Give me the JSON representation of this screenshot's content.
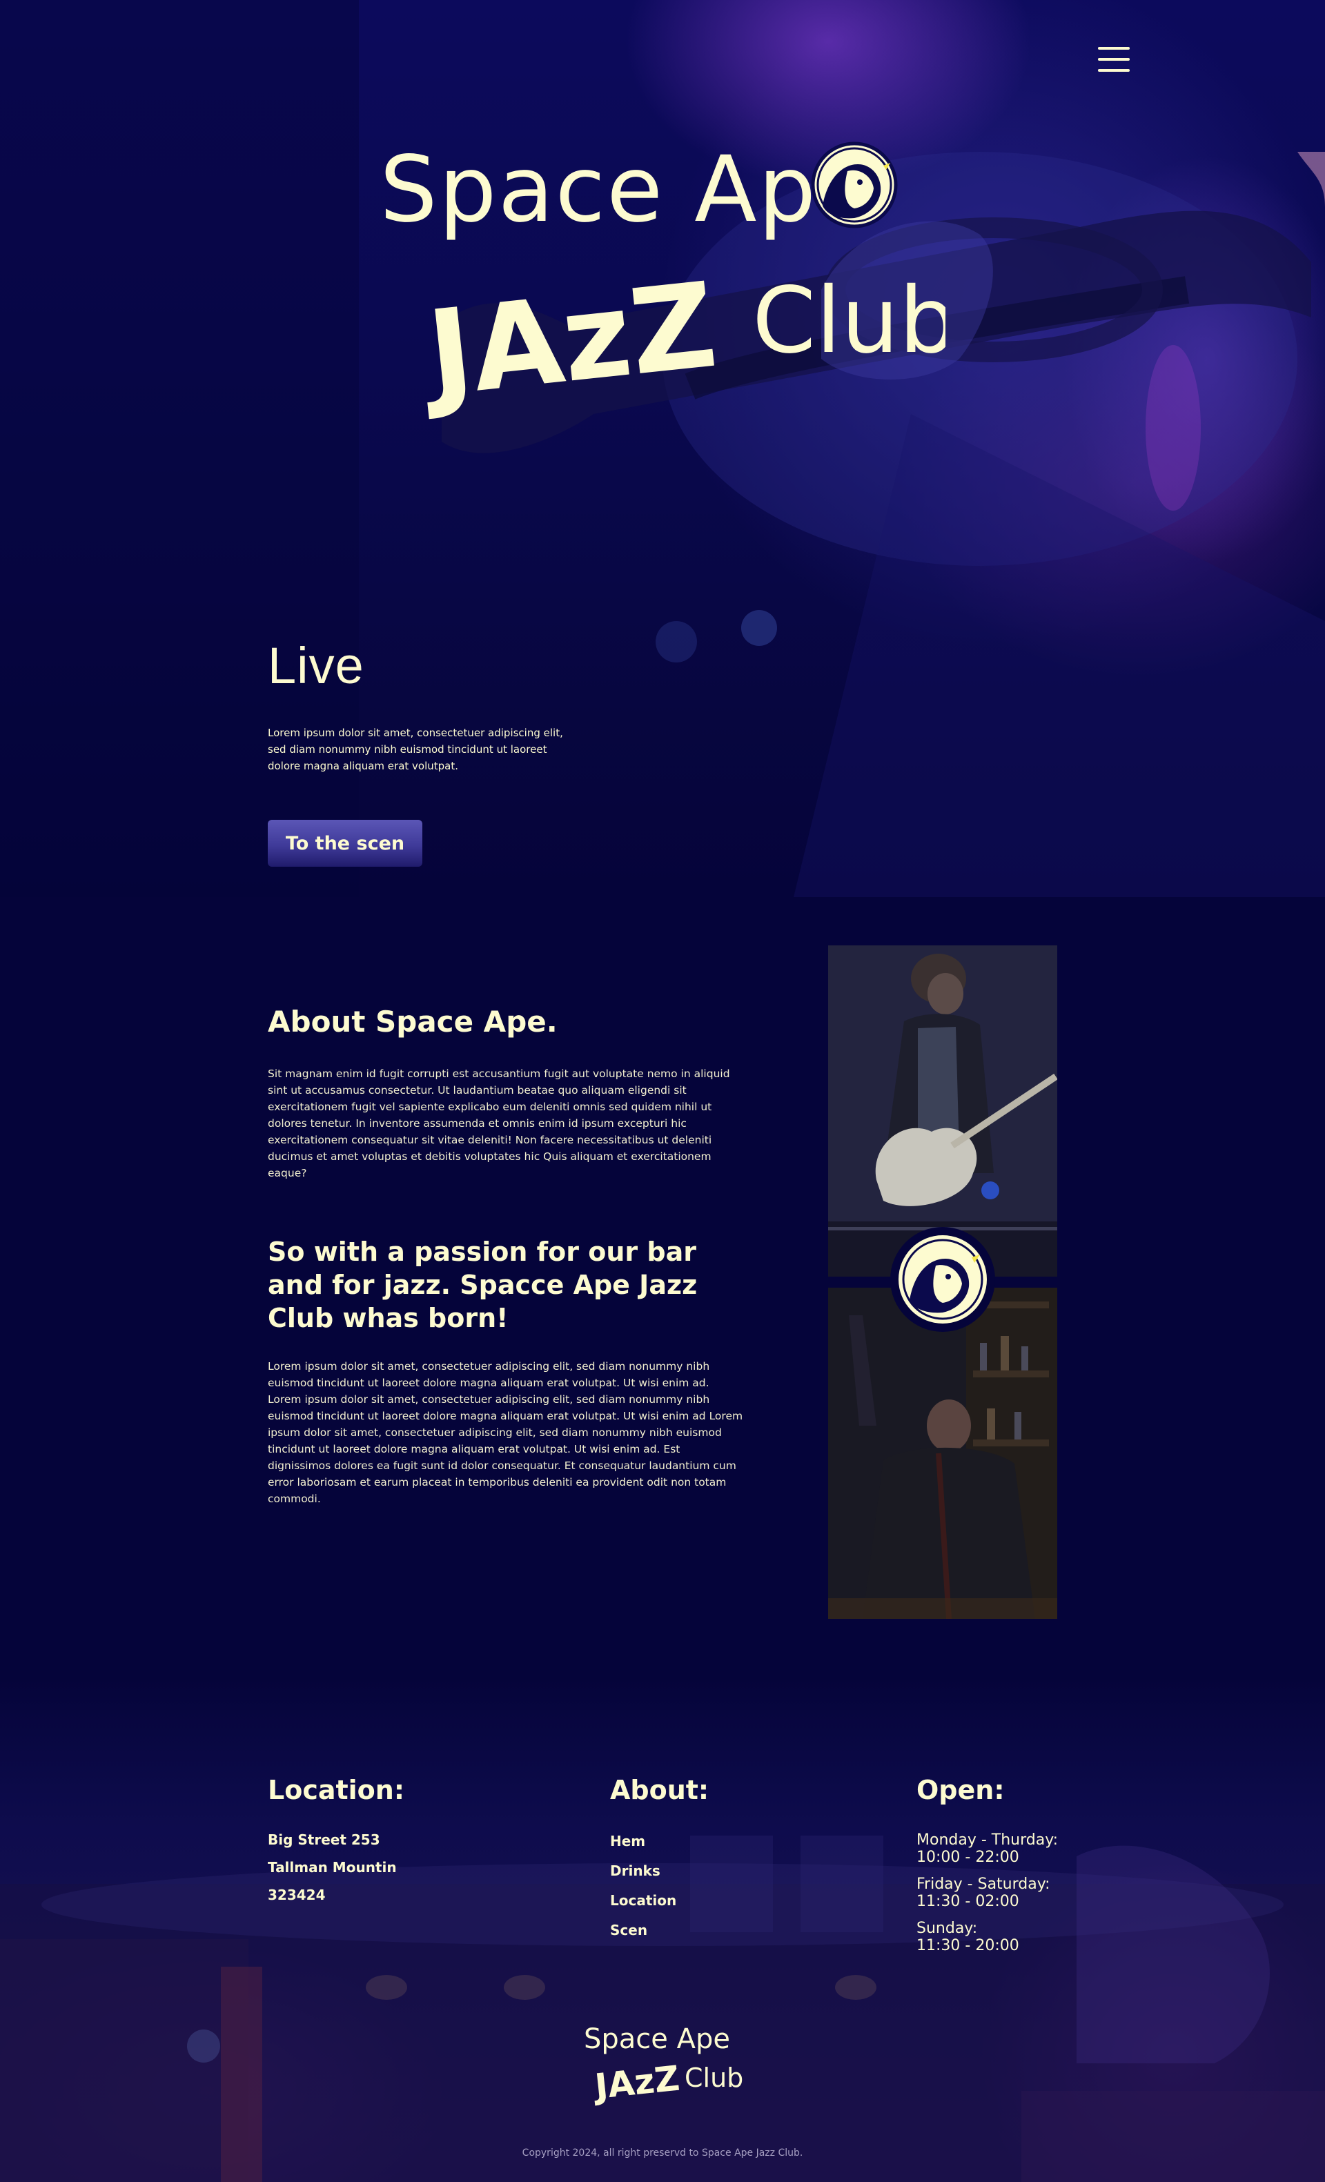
{
  "brand": {
    "logo_line1": "Space Ape",
    "logo_jazz": "JAzZ",
    "logo_club": "Club",
    "accent_color": "#fdfbd0",
    "background_color": "#05043a",
    "button_color": "#4a45a6"
  },
  "header": {
    "menu_icon": "hamburger-menu-icon"
  },
  "hero": {
    "title": "Live",
    "text": "Lorem ipsum dolor sit amet, consectetuer adipiscing elit, sed diam nonummy nibh euismod tincidunt ut laoreet dolore magna aliquam erat volutpat.",
    "button_label": "To the scen"
  },
  "about": {
    "title": "About Space Ape.",
    "text": "Sit magnam enim id fugit corrupti est accusantium fugit aut voluptate nemo in aliquid sint ut accusamus consectetur. Ut laudantium beatae quo aliquam eligendi sit exercitationem fugit vel sapiente explicabo eum deleniti omnis sed quidem nihil ut dolores tenetur. In inventore assumenda et omnis enim id ipsum excepturi hic exercitationem consequatur sit vitae deleniti! Non facere necessitatibus ut deleniti ducimus et amet voluptas et debitis voluptates hic Quis aliquam et exercitationem eaque?",
    "passion_title": "So with a passion for our bar and for jazz. Spacce Ape Jazz Club whas born!",
    "passion_text": "Lorem ipsum dolor sit amet, consectetuer adipiscing elit, sed diam nonummy nibh euismod tincidunt ut laoreet dolore magna aliquam erat volutpat. Ut wisi enim ad. Lorem ipsum dolor sit amet, consectetuer adipiscing elit, sed diam nonummy nibh euismod tincidunt ut laoreet dolore magna aliquam erat volutpat. Ut wisi enim ad Lorem ipsum dolor sit amet, consectetuer adipiscing elit, sed diam nonummy nibh euismod tincidunt ut laoreet dolore magna aliquam erat volutpat. Ut wisi enim ad. Est dignissimos dolores ea fugit sunt id dolor consequatur. Et consequatur laudantium cum error laboriosam et earum placeat in temporibus deleniti ea provident odit non totam commodi."
  },
  "footer": {
    "location": {
      "title": "Location:",
      "lines": [
        "Big Street 253",
        "Tallman Mountin",
        "323424"
      ]
    },
    "about": {
      "title": "About:",
      "links": [
        "Hem",
        "Drinks",
        "Location",
        "Scen"
      ]
    },
    "open": {
      "title": "Open:",
      "hours": [
        {
          "days": "Monday - Thurday:",
          "time": "10:00 - 22:00"
        },
        {
          "days": "Friday - Saturday:",
          "time": "11:30 - 02:00"
        },
        {
          "days": "Sunday:",
          "time": "11:30 - 20:00"
        }
      ]
    },
    "copyright": "Copyright 2024, all right preservd to Space Ape Jazz Club."
  }
}
